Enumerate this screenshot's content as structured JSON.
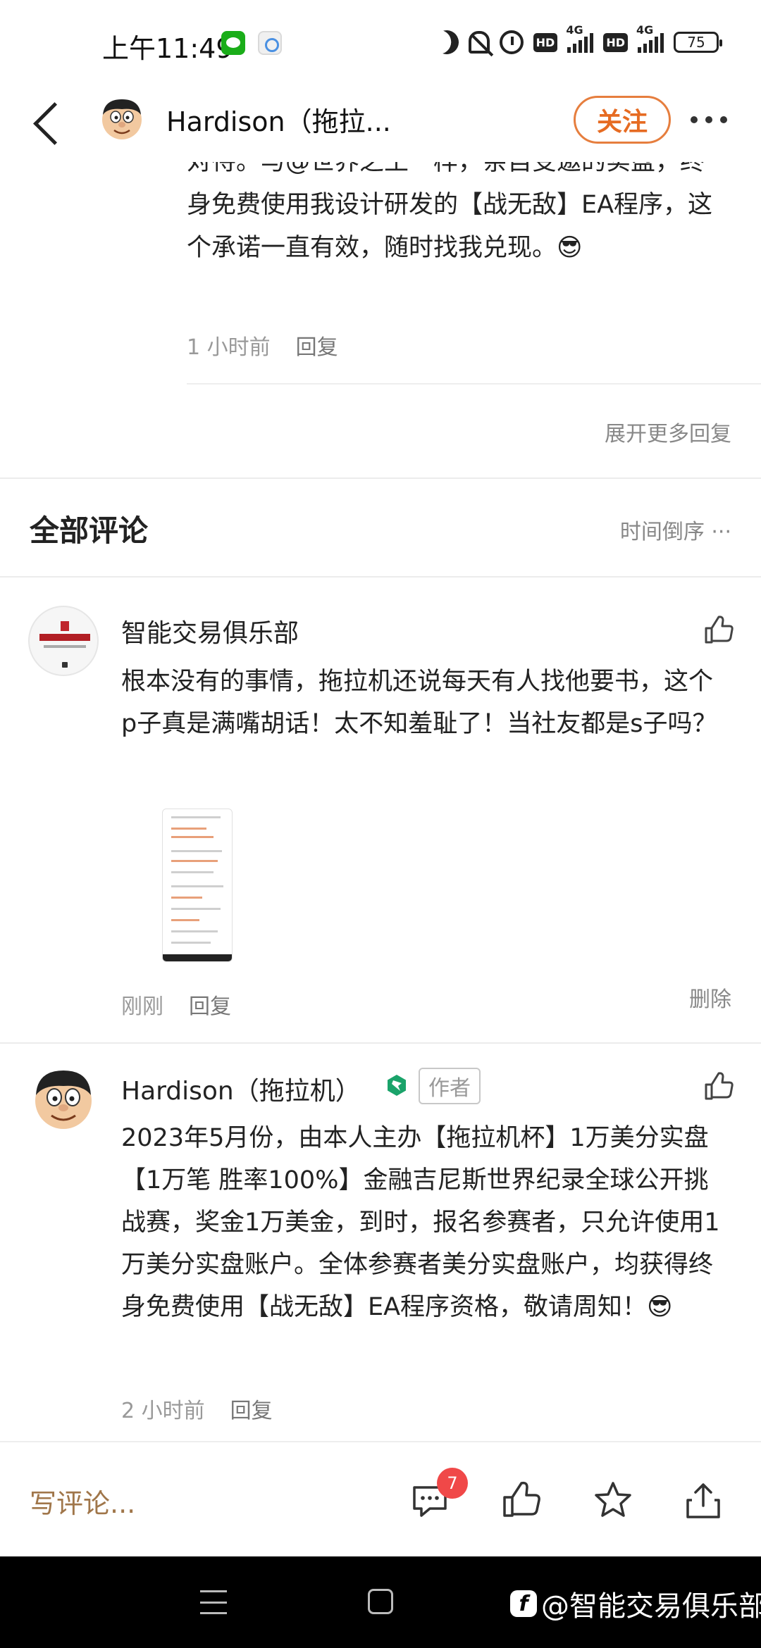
{
  "status_bar": {
    "time": "上午11:49",
    "hd1": "HD",
    "net1": "4G",
    "hd2": "HD",
    "net2": "4G",
    "battery": "75"
  },
  "header": {
    "title": "Hardison（拖拉...",
    "follow_label": "关注"
  },
  "reply": {
    "text": "对待。与@世界之王一样，亲自受邀的实盘，终身免费使用我设计研发的【战无敌】EA程序，这个承诺一直有效，随时找我兑现。😎",
    "time": "1 小时前",
    "reply_label": "回复",
    "expand_label": "展开更多回复"
  },
  "comments_section": {
    "title": "全部评论",
    "sort_label": "时间倒序 ···"
  },
  "comments": [
    {
      "name": "智能交易俱乐部",
      "text": "根本没有的事情，拖拉机还说每天有人找他要书，这个p子真是满嘴胡话！太不知羞耻了！当社友都是s子吗？",
      "time": "刚刚",
      "reply_label": "回复",
      "delete_label": "删除"
    },
    {
      "name": "Hardison（拖拉机）",
      "author_tag": "作者",
      "text": "2023年5月份，由本人主办【拖拉机杯】1万美分实盘【1万笔 胜率100%】金融吉尼斯世界纪录全球公开挑战赛，奖金1万美金，到时，报名参赛者，只允许使用1万美分实盘账户。全体参赛者美分实盘账户，均获得终身免费使用【战无敌】EA程序资格，敬请周知！😎",
      "time": "2 小时前",
      "reply_label": "回复"
    }
  ],
  "bottom_bar": {
    "write_placeholder": "写评论...",
    "comment_count": "7"
  },
  "watermark": {
    "text": "@智能交易俱乐部"
  },
  "colors": {
    "accent_orange": "#e66b22",
    "write_brown": "#a0764a",
    "badge_red": "#f04848",
    "verified_green": "#1aa36a"
  }
}
